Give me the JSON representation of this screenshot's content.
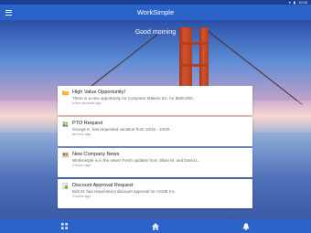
{
  "status_bar": {
    "time": "12:00"
  },
  "app": {
    "title": "WorkSimple"
  },
  "greeting": "Good morning",
  "cards": [
    {
      "icon": "folder-icon",
      "title": "High Value Opportunity!",
      "body": "There is a new opportunity for Computer Makers Inc. for $500,000.",
      "time": "a few seconds ago"
    },
    {
      "icon": "people-icon",
      "title": "PTO Request",
      "body": "George K. has requested vacation from 10/15 - 10/30.",
      "time": "an hour ago"
    },
    {
      "icon": "newspaper-icon",
      "title": "New Company News",
      "body": "Worksimple is in the news! Fresh updates from Jillian M. and David L.",
      "time": "2 hours ago"
    },
    {
      "icon": "document-dollar-icon",
      "title": "Discount Approval Request",
      "body": "Bob M. has requested a discount approval for ACME Inc.",
      "time": "3 hours ago"
    }
  ],
  "bottom_nav": [
    {
      "icon": "grid-icon"
    },
    {
      "icon": "home-icon"
    },
    {
      "icon": "bell-icon"
    }
  ],
  "colors": {
    "primary": "#2b63c9",
    "status_bar": "#1a3f96"
  }
}
